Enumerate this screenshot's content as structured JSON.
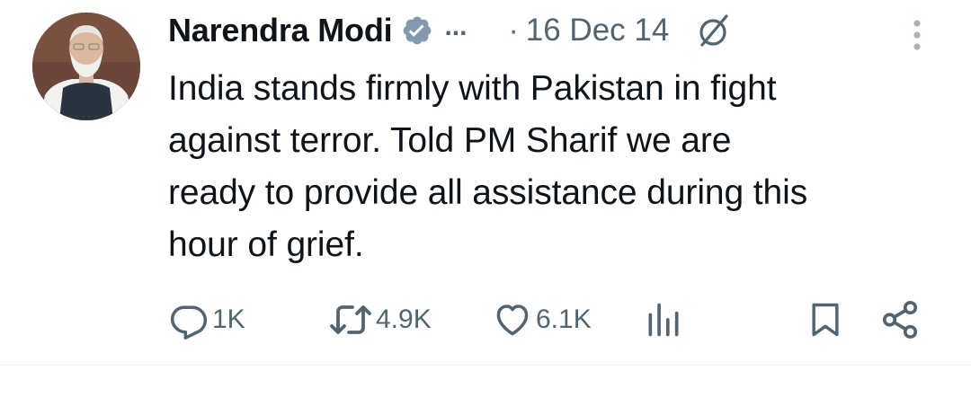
{
  "tweet": {
    "author": {
      "display_name": "Narendra Modi",
      "verified": true,
      "verified_color": "#829aab",
      "overflow_indicator": "...",
      "avatar_icon": "profile-photo"
    },
    "separator": "·",
    "date": "16 Dec 14",
    "grok_icon": "grok-slash-circle-icon",
    "more_icon": "vertical-dots-icon",
    "text_lines": [
      "India stands firmly with Pakistan in fight",
      "against terror. Told PM Sharif we are",
      "ready to provide all assistance during this",
      "hour of grief."
    ],
    "actions": {
      "replies": {
        "icon": "reply-icon",
        "count": "1K"
      },
      "reposts": {
        "icon": "repost-icon",
        "count": "4.9K"
      },
      "likes": {
        "icon": "heart-icon",
        "count": "6.1K"
      },
      "views": {
        "icon": "analytics-icon"
      },
      "bookmark": {
        "icon": "bookmark-icon"
      },
      "share": {
        "icon": "share-icon"
      }
    }
  },
  "colors": {
    "text_primary": "#0f1419",
    "text_secondary": "#536471",
    "background": "#ffffff",
    "divider": "#eff3f4"
  }
}
